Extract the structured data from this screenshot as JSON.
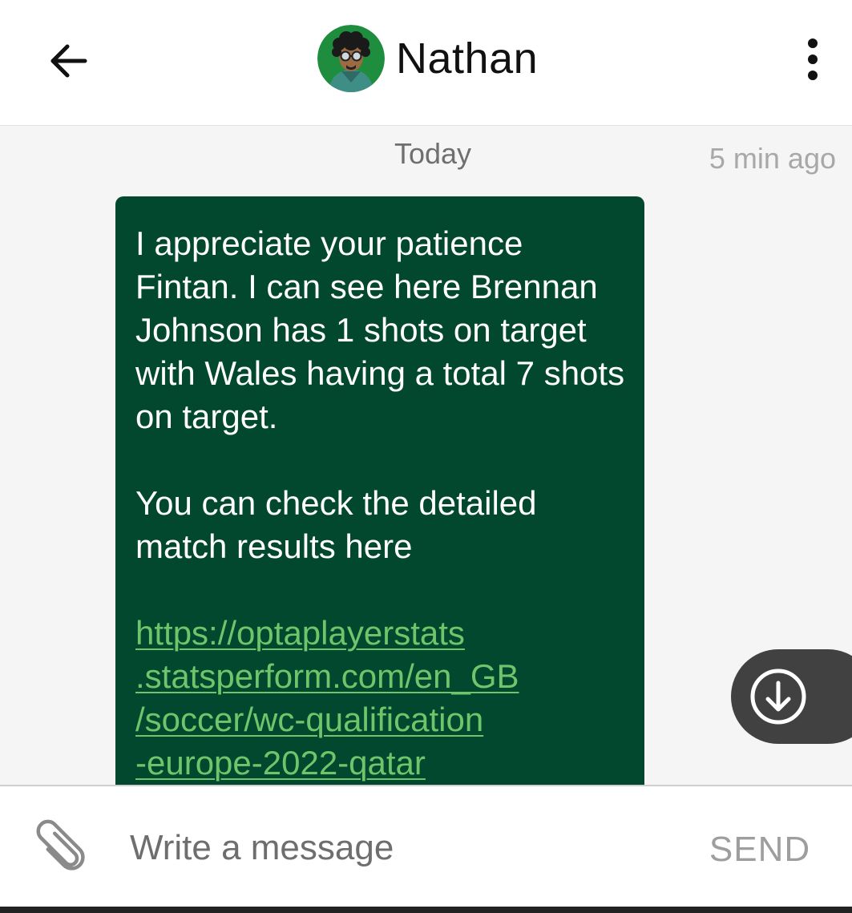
{
  "header": {
    "contact_name": "Nathan",
    "back_icon": "arrow-left-icon",
    "menu_icon": "more-vertical-icon"
  },
  "chat": {
    "day_label": "Today",
    "time_label": "5 min ago",
    "message": {
      "para1": "I appreciate your patience Fintan. I can see here Brennan Johnson has 1 shots on target with Wales having a total 7 shots on target.",
      "para2": "You can check the detailed match results here",
      "link": "https://optaplayerstats.statsperform.com/en_GB/soccer/wc-qualification-europe-2022-qatar"
    },
    "scroll_icon": "arrow-down-circle-icon"
  },
  "composer": {
    "placeholder": "Write a message",
    "value": "",
    "send_label": "SEND",
    "attach_icon": "paperclip-icon"
  },
  "colors": {
    "bubble": "#01482f",
    "link": "#6fc66a",
    "avatar_ring": "#1e8e3e"
  }
}
